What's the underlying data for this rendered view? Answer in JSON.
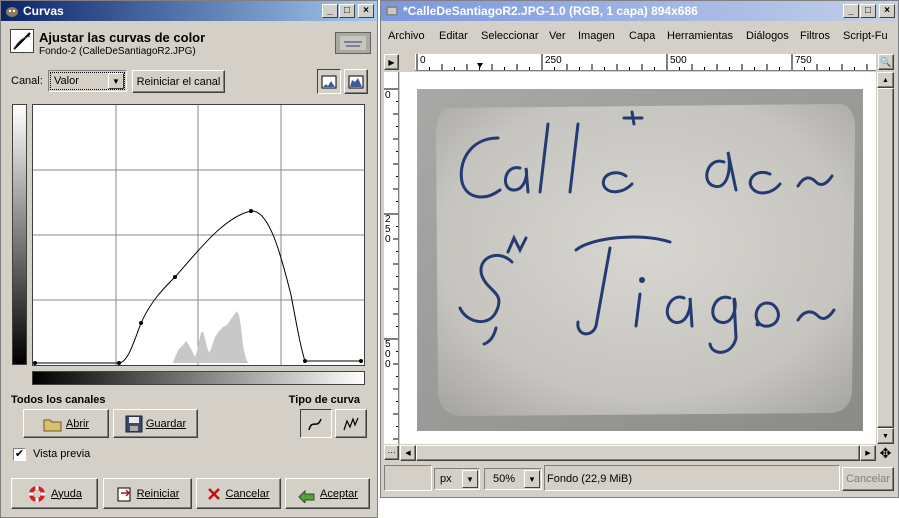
{
  "curves": {
    "title": "Curvas",
    "heading": "Ajustar las curvas de color",
    "subheading": "Fondo-2 (CalleDeSantiagoR2.JPG)",
    "channel_label": "Canal:",
    "channel_value": "Valor",
    "reset_channel": "Reiniciar el canal",
    "all_channels": "Todos los canales",
    "curve_type": "Tipo de curva",
    "open": "Abrir",
    "save": "Guardar",
    "preview": "Vista previa",
    "preview_checked": true,
    "help": "Ayuda",
    "reset": "Reiniciar",
    "cancel": "Cancelar",
    "accept": "Aceptar"
  },
  "image_window": {
    "title": "*CalleDeSantiagoR2.JPG-1.0 (RGB, 1 capa) 894x686",
    "menu": [
      "Archivo",
      "Editar",
      "Seleccionar",
      "Ver",
      "Imagen",
      "Capa",
      "Herramientas",
      "Diálogos",
      "Filtros",
      "Script-Fu"
    ],
    "ruler_h": [
      "0",
      "250",
      "500",
      "750"
    ],
    "ruler_v": [
      "0",
      "250",
      "500"
    ],
    "unit": "px",
    "zoom": "50%",
    "status": "Fondo (22,9 MiB)",
    "cancel": "Cancelar"
  },
  "sign_text": {
    "line1": "Calle de~",
    "line2": "S,Tiago~"
  }
}
